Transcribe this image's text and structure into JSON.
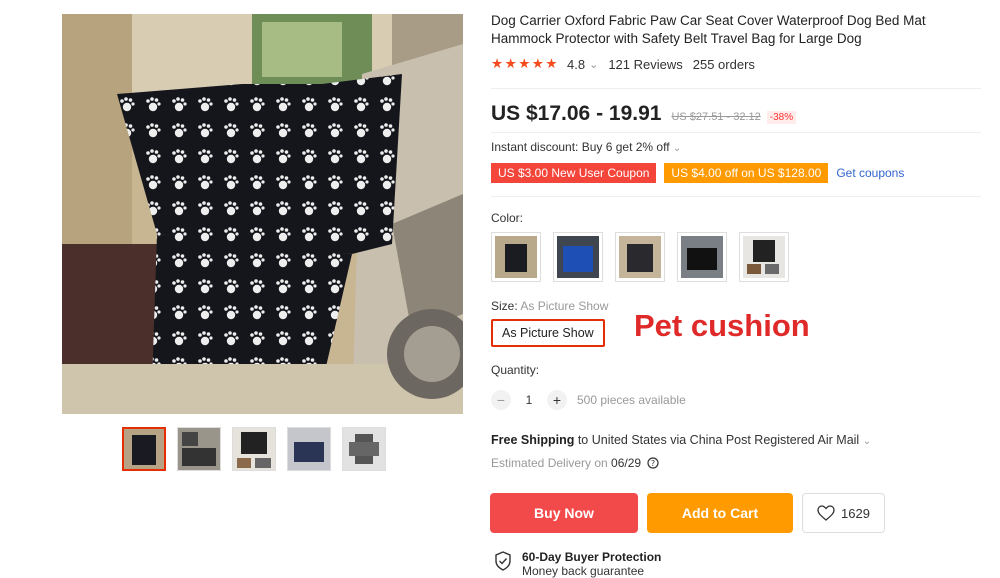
{
  "product": {
    "title": "Dog Carrier Oxford Fabric Paw Car Seat Cover Waterproof Dog Bed Mat Hammock Protector with Safety Belt Travel Bag for Large Dog",
    "rating_stars": "★★★★★",
    "rating_value": "4.8",
    "rating_caret": "⌄",
    "reviews": "121 Reviews",
    "orders": "255 orders"
  },
  "price": {
    "current": "US $17.06 - 19.91",
    "original": "US $27.51 - 32.12",
    "discount": "-38%"
  },
  "instant_discount": "Instant discount: Buy 6 get 2% off",
  "coupons": {
    "red": "US $3.00 New User Coupon",
    "orange": "US $4.00 off on US $128.00",
    "get": "Get coupons"
  },
  "color": {
    "label": "Color:",
    "swatches": [
      "dark-seat",
      "blue-trunk",
      "seat-cover",
      "trunk-black",
      "black-mat"
    ]
  },
  "size": {
    "label": "Size:",
    "value": "As Picture Show",
    "button": "As Picture Show"
  },
  "annotation": "Pet cushion",
  "quantity": {
    "label": "Quantity:",
    "minus": "−",
    "value": "1",
    "plus": "+",
    "available": "500 pieces available"
  },
  "shipping": {
    "bold": "Free Shipping",
    "rest": " to United States via China Post Registered Air Mail",
    "delivery_label": "Estimated Delivery on ",
    "delivery_date": "06/29"
  },
  "actions": {
    "buy": "Buy Now",
    "cart": "Add to Cart",
    "wish_count": "1629"
  },
  "protection": {
    "title": "60-Day Buyer Protection",
    "subtitle": "Money back guarantee"
  },
  "colors": {
    "accent_red": "#f24a4a",
    "accent_orange": "#ff9a00",
    "link_blue": "#3366cc"
  }
}
